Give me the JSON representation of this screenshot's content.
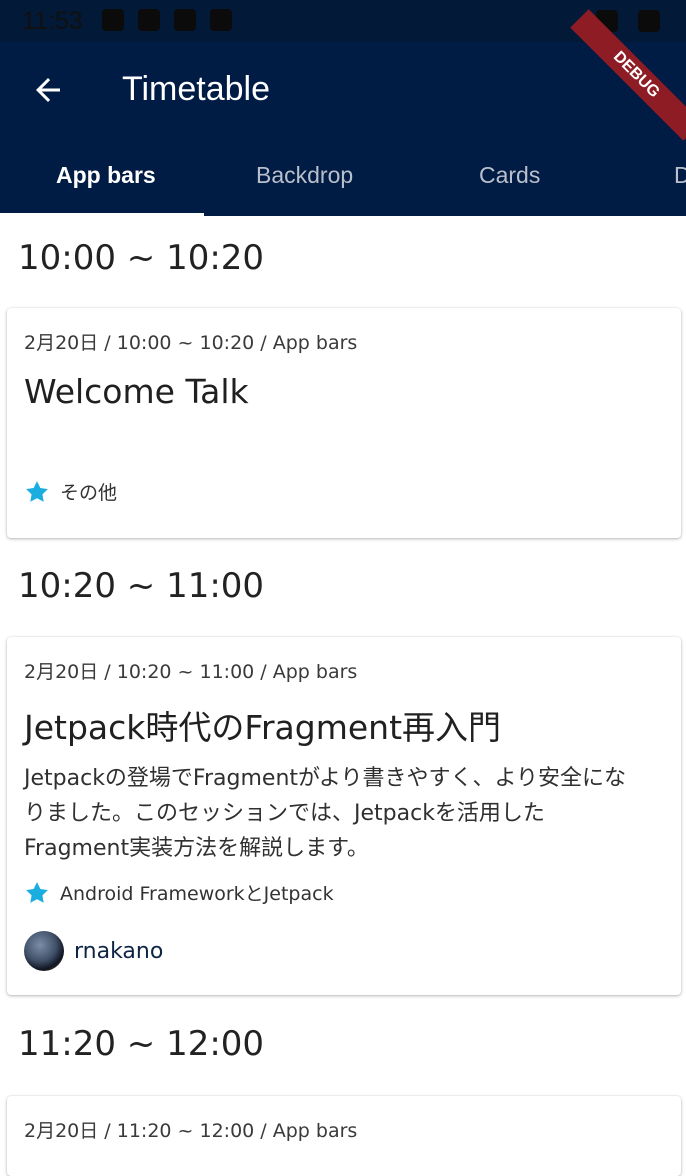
{
  "status_bar": {
    "time": "11:53",
    "icons": [
      "settings-icon",
      "shield-icon",
      "sim-icon",
      "play-store-icon"
    ],
    "right_icons": [
      "wifi-icon",
      "battery-icon"
    ]
  },
  "app_bar": {
    "title": "Timetable",
    "back_icon": "arrow-back-icon"
  },
  "debug_banner": "DEBUG",
  "tabs": [
    {
      "label": "App bars",
      "active": true
    },
    {
      "label": "Backdrop"
    },
    {
      "label": "Cards"
    },
    {
      "label": "D"
    }
  ],
  "timeslots": [
    {
      "label": "10:00 ~ 10:20"
    },
    {
      "label": "10:20 ~ 11:00"
    },
    {
      "label": "11:20 ~ 12:00"
    }
  ],
  "sessions": [
    {
      "meta": "2月20日 / 10:00 ~ 10:20 / App bars",
      "title": "Welcome Talk",
      "description": "",
      "tag": "その他"
    },
    {
      "meta": "2月20日 / 10:20 ~ 11:00 / App bars",
      "title": "Jetpack時代のFragment再入門",
      "description_lines": [
        "Jetpackの登場でFragmentがより書きやすく、より安全にな",
        "りました。このセッションでは、Jetpackを活用した",
        "Fragment実装方法を解説します。"
      ],
      "tag": "Android FrameworkとJetpack",
      "speaker": "rnakano"
    },
    {
      "meta": "2月20日 / 11:20 ~ 12:00 / App bars"
    }
  ],
  "colors": {
    "appbar": "#001b44",
    "star": "#1aaee0",
    "debug": "#8e1c24"
  }
}
